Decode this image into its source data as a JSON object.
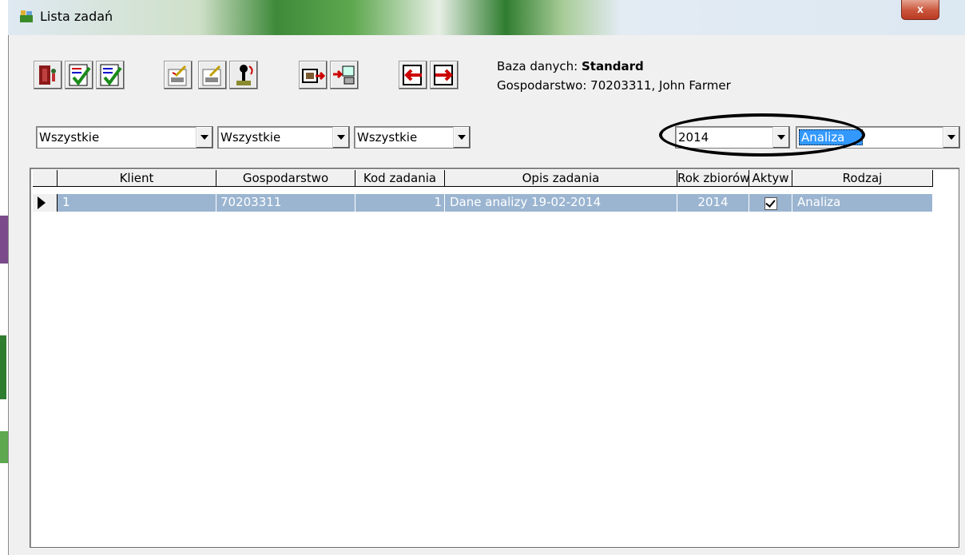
{
  "window": {
    "title": "Lista zadań",
    "close_label": "x"
  },
  "toolbar": {
    "buttons": [
      {
        "name": "exit-icon"
      },
      {
        "name": "check-all-icon"
      },
      {
        "name": "check-selected-icon"
      },
      {
        "name": "edit-task-icon"
      },
      {
        "name": "new-task-icon"
      },
      {
        "name": "joystick-icon"
      },
      {
        "name": "export-icon"
      },
      {
        "name": "transfer-icon"
      },
      {
        "name": "import-left-icon"
      },
      {
        "name": "import-right-icon"
      }
    ]
  },
  "info": {
    "db_label": "Baza danych: ",
    "db_value": "Standard",
    "farm_line": "Gospodarstwo: 70203311, John Farmer"
  },
  "filters": {
    "filter1": "Wszystkie",
    "filter2": "Wszystkie",
    "filter3": "Wszystkie",
    "year": "2014",
    "type": "Analiza"
  },
  "grid": {
    "columns": [
      "Klient",
      "Gospodarstwo",
      "Kod zadania",
      "Opis zadania",
      "Rok zbiorów",
      "Aktyw",
      "Rodzaj"
    ],
    "rows": [
      {
        "klient": "1",
        "gospodarstwo": "70203311",
        "kod": "1",
        "opis": "Dane analizy 19-02-2014",
        "rok": "2014",
        "aktywne": true,
        "rodzaj": "Analiza"
      }
    ]
  }
}
